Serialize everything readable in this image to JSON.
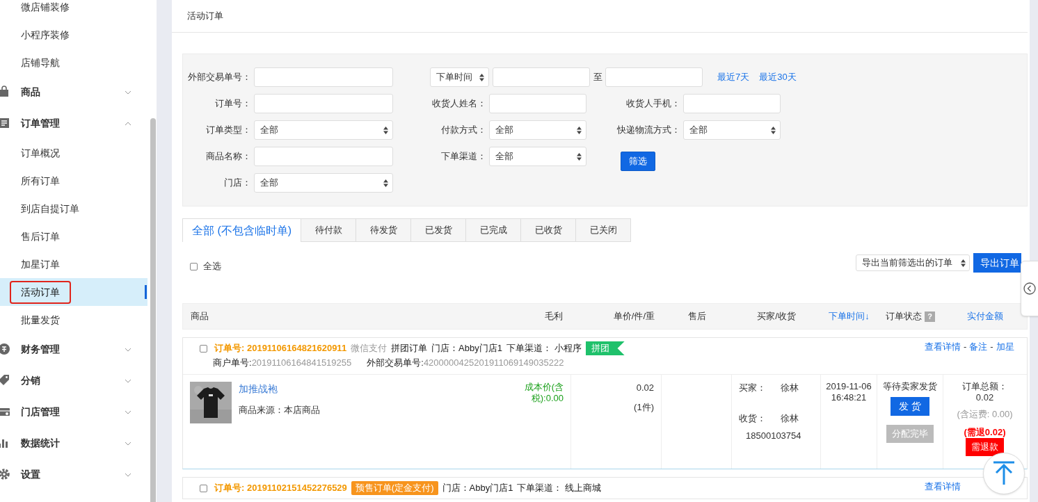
{
  "sidebar": {
    "items": [
      {
        "kind": "link",
        "label": "微店铺装修",
        "selected": false
      },
      {
        "kind": "link",
        "label": "小程序装修",
        "selected": false
      },
      {
        "kind": "link",
        "label": "店铺导航",
        "selected": false
      },
      {
        "kind": "group",
        "label": "商品",
        "expanded": false
      },
      {
        "kind": "group",
        "label": "订单管理",
        "expanded": true,
        "children": [
          {
            "label": "订单概况",
            "selected": false
          },
          {
            "label": "所有订单",
            "selected": false
          },
          {
            "label": "到店自提订单",
            "selected": false
          },
          {
            "label": "售后订单",
            "selected": false
          },
          {
            "label": "加星订单",
            "selected": false
          },
          {
            "label": "活动订单",
            "selected": true
          },
          {
            "label": "批量发货",
            "selected": false
          }
        ]
      },
      {
        "kind": "group",
        "label": "财务管理",
        "expanded": false
      },
      {
        "kind": "group",
        "label": "分销",
        "expanded": false
      },
      {
        "kind": "group",
        "label": "门店管理",
        "expanded": false
      },
      {
        "kind": "group",
        "label": "数据统计",
        "expanded": false
      },
      {
        "kind": "group",
        "label": "设置",
        "expanded": false
      }
    ]
  },
  "page_title": "活动订单",
  "filters": [
    [
      {
        "kind": "text",
        "label": "外部交易单号："
      },
      {
        "kind": "date-range",
        "select": "下单时间",
        "separator": "至",
        "links": [
          "最近7天",
          "最近30天"
        ]
      }
    ],
    [
      {
        "kind": "text",
        "label": "订单号："
      },
      {
        "kind": "text",
        "label": "收货人姓名："
      },
      {
        "kind": "text",
        "label": "收货人手机："
      }
    ],
    [
      {
        "kind": "select",
        "label": "订单类型：",
        "value": "全部"
      },
      {
        "kind": "select",
        "label": "付款方式：",
        "value": "全部"
      },
      {
        "kind": "select",
        "label": "快递物流方式：",
        "value": "全部"
      }
    ],
    [
      {
        "kind": "text",
        "label": "商品名称："
      },
      {
        "kind": "select",
        "label": "下单渠道：",
        "value": "全部"
      },
      {
        "kind": "button",
        "label": "筛选"
      }
    ],
    [
      {
        "kind": "select",
        "label": "门店：",
        "value": "全部"
      }
    ]
  ],
  "tabs": [
    {
      "label": "全部 (不包含临时单)",
      "selected": true
    },
    {
      "label": "待付款",
      "selected": false
    },
    {
      "label": "待发货",
      "selected": false
    },
    {
      "label": "已发货",
      "selected": false
    },
    {
      "label": "已完成",
      "selected": false
    },
    {
      "label": "已收货",
      "selected": false
    },
    {
      "label": "已关闭",
      "selected": false
    }
  ],
  "select_all": {
    "label": "全选",
    "checked": false
  },
  "export": {
    "select": "导出当前筛选出的订单",
    "button": "导出订单"
  },
  "table": {
    "columns": [
      {
        "label": "商品",
        "kind": "plain"
      },
      {
        "label": "毛利",
        "kind": "plain"
      },
      {
        "label": "单价/件/重",
        "kind": "plain"
      },
      {
        "label": "售后",
        "kind": "plain"
      },
      {
        "label": "买家/收货",
        "kind": "plain"
      },
      {
        "label": "下单时间↓",
        "kind": "sort"
      },
      {
        "label": "订单状态",
        "kind": "help",
        "help": "?"
      },
      {
        "label": "实付金额",
        "kind": "sort"
      }
    ]
  },
  "orders": [
    {
      "checked": false,
      "line1": [
        {
          "kind": "number",
          "text": "订单号: 20191106164821620911"
        },
        {
          "kind": "muted",
          "text": "微信支付"
        },
        {
          "kind": "plain",
          "text": "拼团订单"
        },
        {
          "kind": "plain",
          "text": "门店：Abby门店1"
        },
        {
          "kind": "plain",
          "text": "下单渠道：  小程序"
        },
        {
          "kind": "flag",
          "text": "拼团"
        }
      ],
      "line2": [
        {
          "kind": "plain",
          "text": "商户单号: "
        },
        {
          "kind": "muted",
          "text": "20191106164841519255"
        },
        {
          "kind": "gap"
        },
        {
          "kind": "plain",
          "text": "外部交易单号: "
        },
        {
          "kind": "muted",
          "text": "4200000425201911069149035222"
        }
      ],
      "links": [
        "查看详情",
        "备注",
        "加星"
      ],
      "link_separator": "-",
      "body": {
        "product": {
          "name": "加推战袍",
          "source": "商品来源：本店商品",
          "cost": "成本价(含税):0.00"
        },
        "price": "0.02",
        "quantity": "(1件)",
        "buyer": [
          {
            "label": "买家：",
            "value": "徐林"
          },
          {
            "label": "收货：",
            "value": "徐林"
          }
        ],
        "phone": "18500103754",
        "time": "2019-11-06 16:48:21",
        "status": "等待卖家发货",
        "actions": [
          {
            "kind": "primary",
            "label": "发 货"
          },
          {
            "kind": "disabled",
            "label": "分配完毕"
          }
        ],
        "amount": {
          "label": "订单总额：",
          "total": "0.02",
          "shipping": "(含运费: 0.00)",
          "refund": "(需退0.02)",
          "button": "需退款"
        }
      }
    },
    {
      "checked": false,
      "line1": [
        {
          "kind": "number",
          "text": "订单号: 20191102151452276529"
        },
        {
          "kind": "tag",
          "text": "预售订单(定金支付)"
        },
        {
          "kind": "plain",
          "text": "门店：Abby门店1"
        },
        {
          "kind": "plain",
          "text": "下单渠道：  线上商城"
        }
      ],
      "links": [
        "查看详情"
      ]
    }
  ]
}
